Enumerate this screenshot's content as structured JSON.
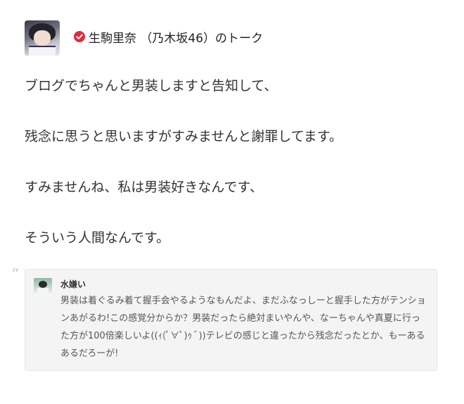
{
  "header": {
    "member_title": "生駒里奈 （乃木坂46）のトーク",
    "verified_icon": "check-badge-icon",
    "verified_color": "#e02b3b"
  },
  "post": {
    "lines": [
      "ブログでちゃんと男装しますと告知して、",
      "",
      "残念に思うと思いますがすみませんと謝罪してます。",
      "",
      "すみませんね、私は男装好きなんです、",
      "",
      "そういう人間なんです。"
    ]
  },
  "comment": {
    "username": "水嫌い",
    "text": "男装は着ぐるみ着て握手会やるようなもんだよ、まだふなっしーと握手した方がテンションあがるわ!この感覚分からか？男装だったら絶対まいやんや、なーちゃんや真夏に行った方が100倍楽しいよ((ｨ(ﾟ∀ﾟ)ｩ ﾞ))テレビの感じと違ったから残念だったとか、もーあるあるだろーが!"
  }
}
